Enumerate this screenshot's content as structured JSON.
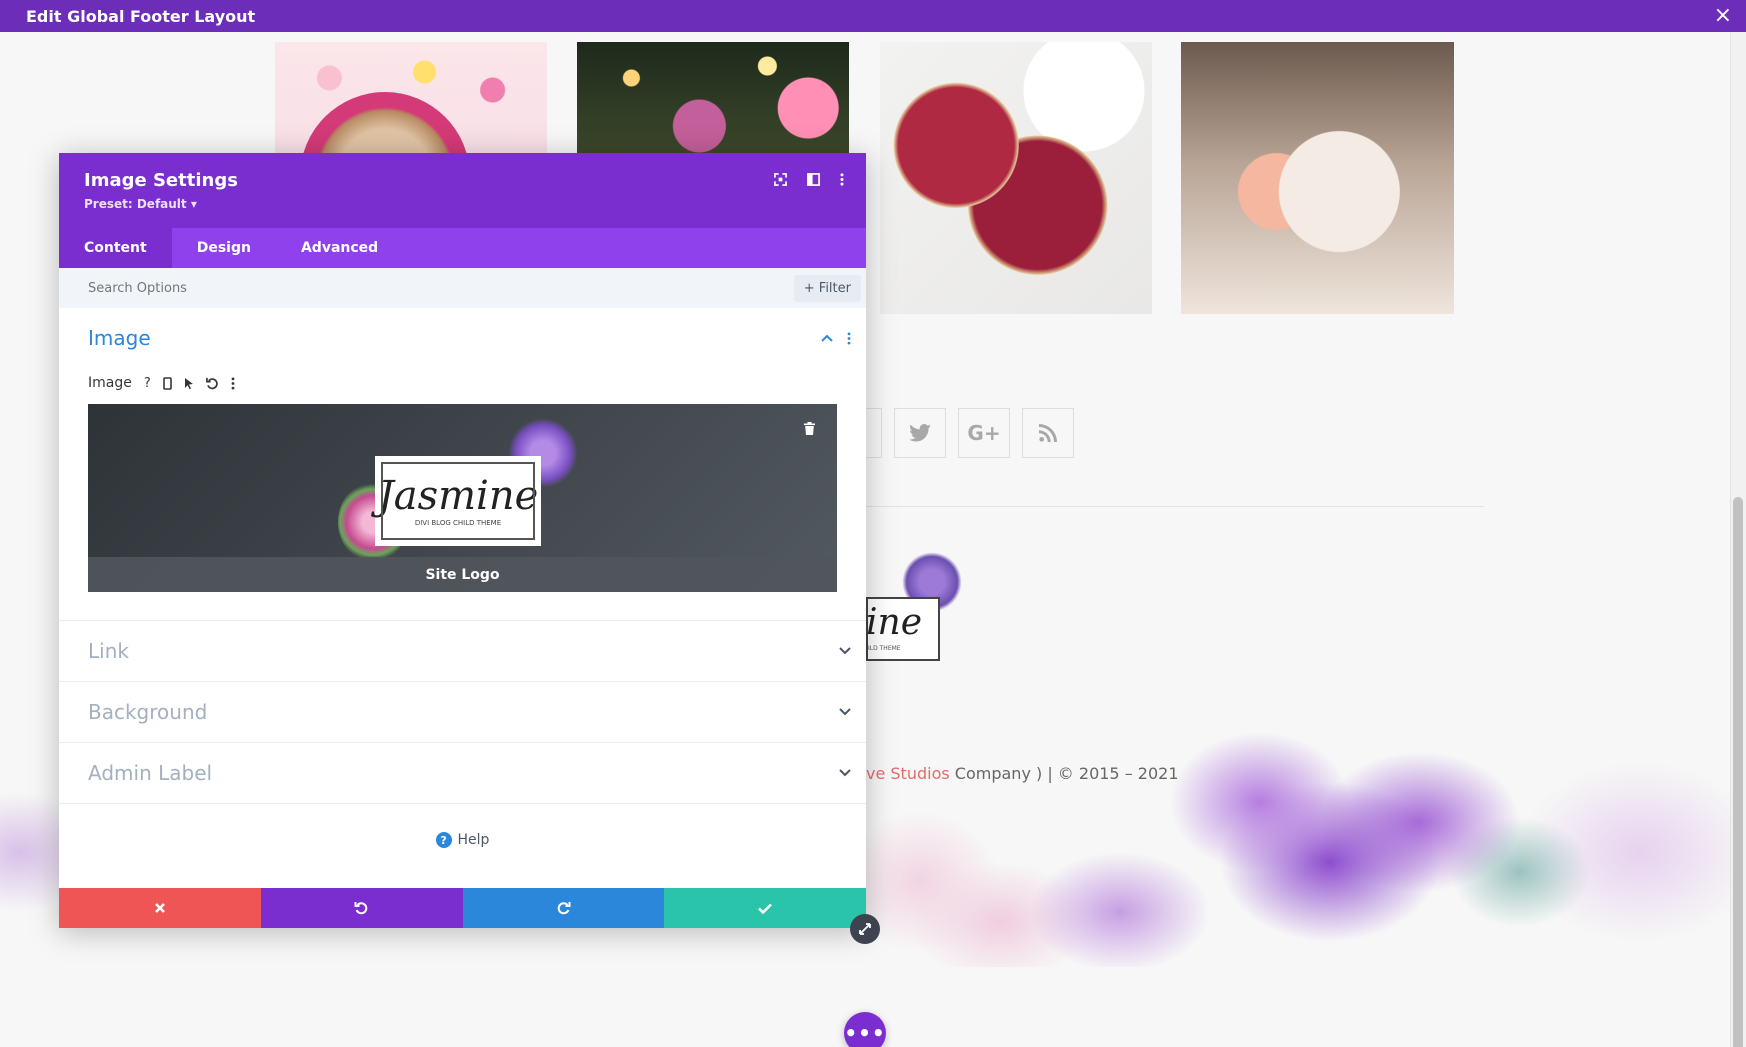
{
  "topbar": {
    "title": "Edit Global Footer Layout",
    "close_icon": "×"
  },
  "modal": {
    "title": "Image Settings",
    "preset": "Preset: Default ▾",
    "tabs": [
      "Content",
      "Design",
      "Advanced"
    ],
    "active_tab": "Content",
    "search_placeholder": "Search Options",
    "filter_label": "+ Filter",
    "image_section": {
      "title": "Image",
      "option_label": "Image",
      "preview_caption": "Site Logo",
      "logo_word": "Jasmine",
      "logo_sub": "DIVI BLOG CHILD THEME"
    },
    "sections": [
      "Link",
      "Background",
      "Admin Label"
    ],
    "help_label": "Help"
  },
  "page": {
    "copyright_link": "ve Studios",
    "copyright_rest": " Company ) | © 2015 – 2021",
    "logo_fragment": "ine",
    "logo_fragment_sub": "ILD THEME"
  },
  "colors": {
    "purple_dark": "#6c2eb9",
    "purple": "#7a2ed0",
    "purple_light": "#8f42ec",
    "blue": "#2b87da",
    "red": "#ef5555",
    "teal": "#29c4a9"
  }
}
